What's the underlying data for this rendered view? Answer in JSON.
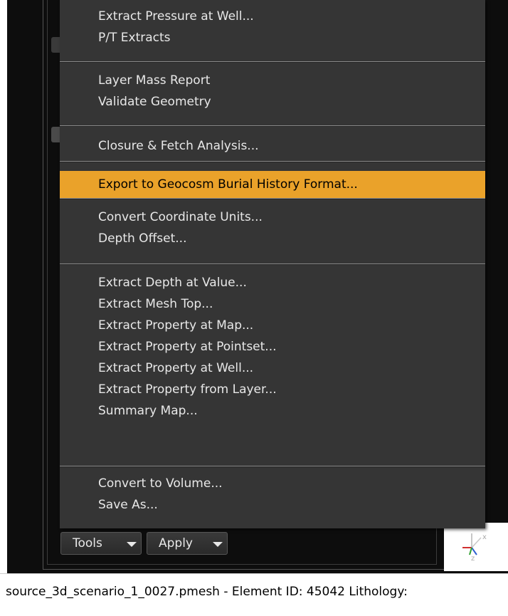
{
  "menu": {
    "groups": [
      [
        "Extract Pressure at Well...",
        "P/T Extracts"
      ],
      [
        "Layer Mass Report",
        "Validate Geometry"
      ],
      [
        "Closure & Fetch Analysis..."
      ],
      [
        "Export to Geocosm Burial History Format..."
      ],
      [
        "Convert Coordinate Units...",
        "Depth Offset..."
      ],
      [
        "Extract Depth at Value...",
        "Extract Mesh Top...",
        "Extract Property at Map...",
        "Extract Property at Pointset...",
        "Extract Property at Well...",
        "Extract Property from Layer...",
        "Summary Map..."
      ],
      [
        "Convert to Volume...",
        "Save As..."
      ]
    ],
    "highlighted": "Export to Geocosm Burial History Format..."
  },
  "toolbar": {
    "tools_label": "Tools",
    "apply_label": "Apply"
  },
  "status": {
    "text": "source_3d_scenario_1_0027.pmesh - Element ID: 45042  Lithology:"
  },
  "colors": {
    "menu_bg": "#353535",
    "highlight": "#eaa22a",
    "separator": "#8a8a8a"
  },
  "icons": [
    "axes-icon",
    "caret-down-icon"
  ]
}
